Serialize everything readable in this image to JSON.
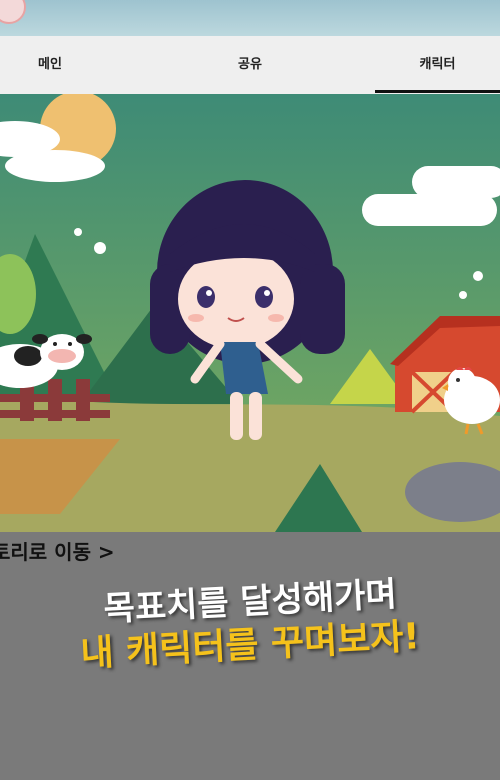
{
  "tabs": {
    "main": "메인",
    "share": "공유",
    "character": "캐릭터"
  },
  "story_link": "토리로 이동 >",
  "promo": {
    "line1": "목표치를 달성해가며",
    "line2": "내 캐릭터를 꾸며보자!"
  },
  "colors": {
    "accent_yellow": "#f5c21b",
    "tab_bg": "#efefef",
    "background_gray": "#7a7a7a"
  }
}
